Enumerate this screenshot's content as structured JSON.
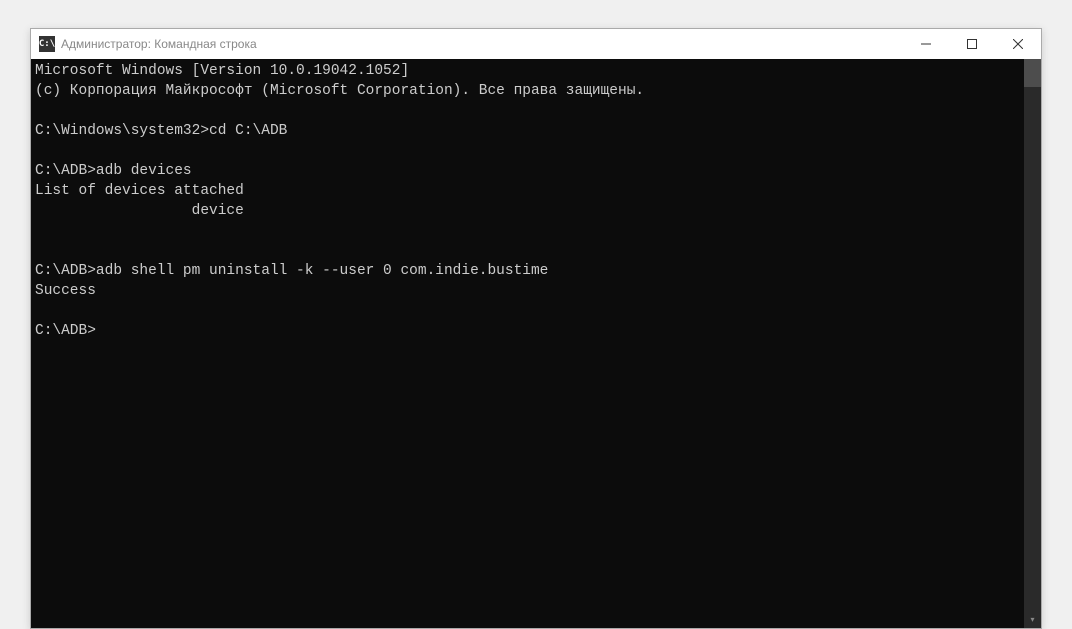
{
  "window": {
    "title": "Администратор: Командная строка",
    "icon_label": "C:\\"
  },
  "terminal": {
    "lines": [
      "Microsoft Windows [Version 10.0.19042.1052]",
      "(c) Корпорация Майкрософт (Microsoft Corporation). Все права защищены.",
      "",
      "C:\\Windows\\system32>cd C:\\ADB",
      "",
      "C:\\ADB>adb devices",
      "List of devices attached",
      "                  device",
      "",
      "",
      "C:\\ADB>adb shell pm uninstall -k --user 0 com.indie.bustime",
      "Success",
      "",
      "C:\\ADB>"
    ]
  }
}
